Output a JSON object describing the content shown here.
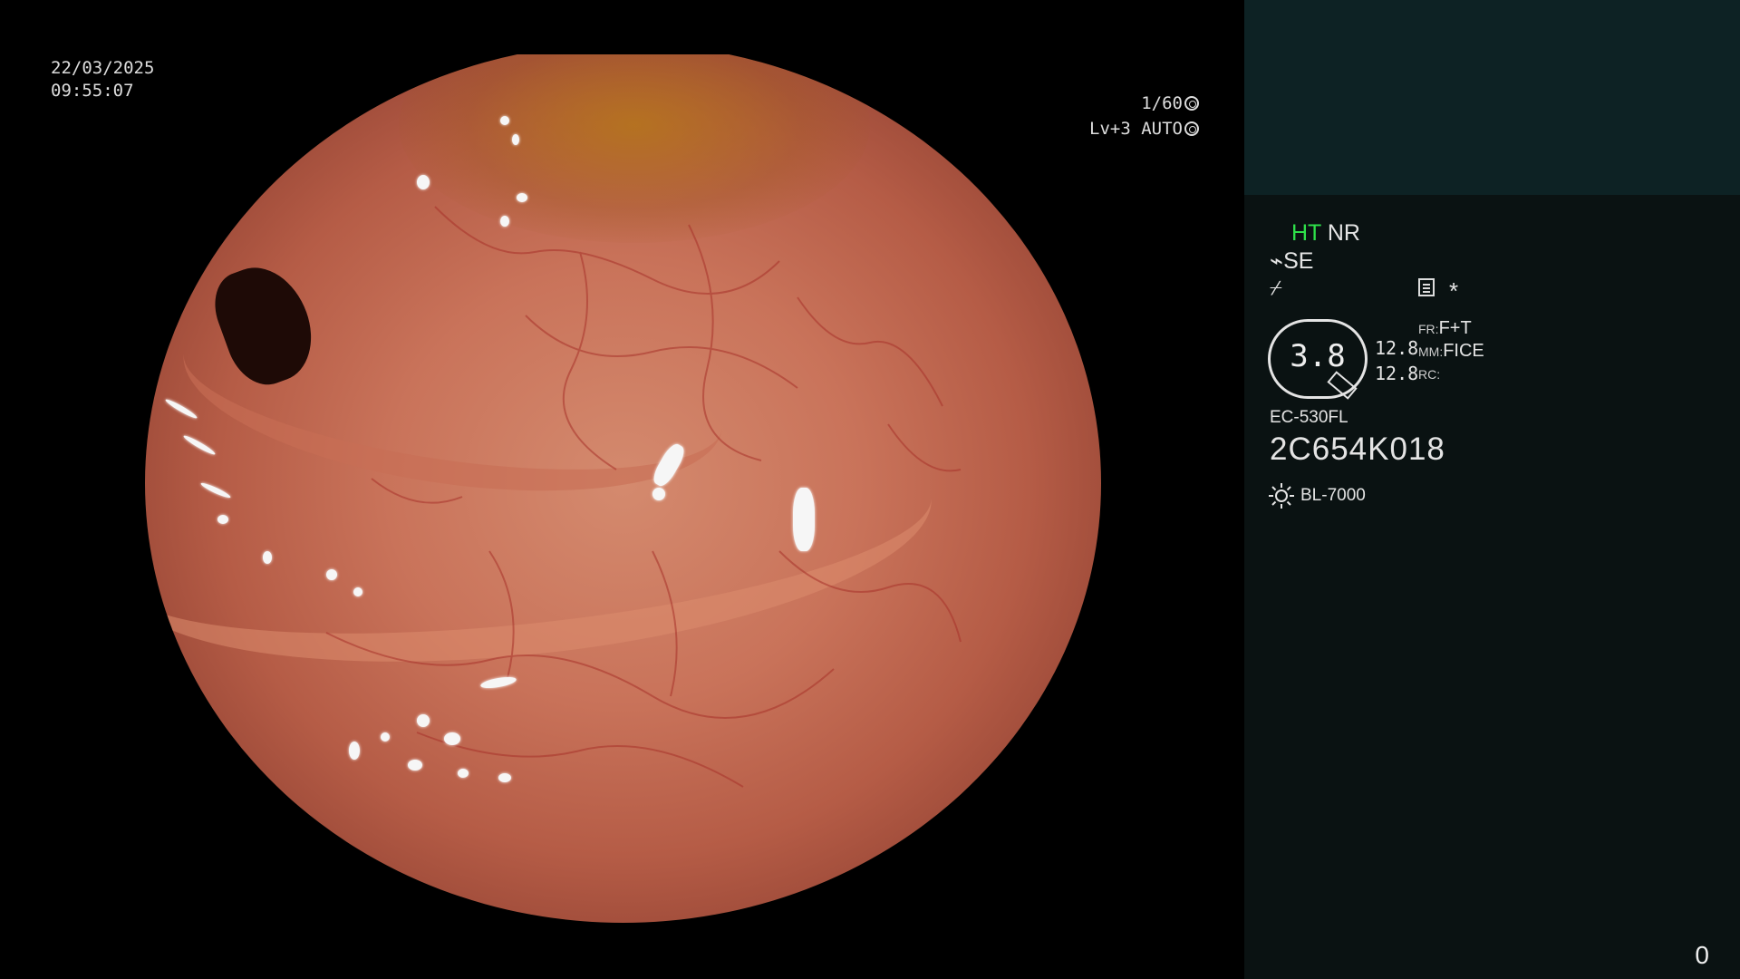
{
  "overlay": {
    "date": "22/03/2025",
    "time": "09:55:07",
    "shutter": "1/60",
    "level": "Lv+3",
    "iris": "AUTO"
  },
  "panel": {
    "ht": "HT",
    "nr": "NR",
    "se": "SE",
    "slash_symbol": "⌿",
    "star": "*",
    "gauge_value": "3.8",
    "num_top": "12.8",
    "num_bottom": "12.8",
    "fr_label": "FR:",
    "fr_value": "F+T",
    "mm_label": "MM:",
    "mm_value": "FICE",
    "rc_label": "RC:",
    "model": "EC-530FL",
    "serial": "2C654K018",
    "light_source": "BL-7000",
    "counter": "0"
  },
  "colors": {
    "ht_green": "#2ee04a",
    "panel_bg": "#0a1212",
    "panel_top_bg": "#0d2224"
  }
}
